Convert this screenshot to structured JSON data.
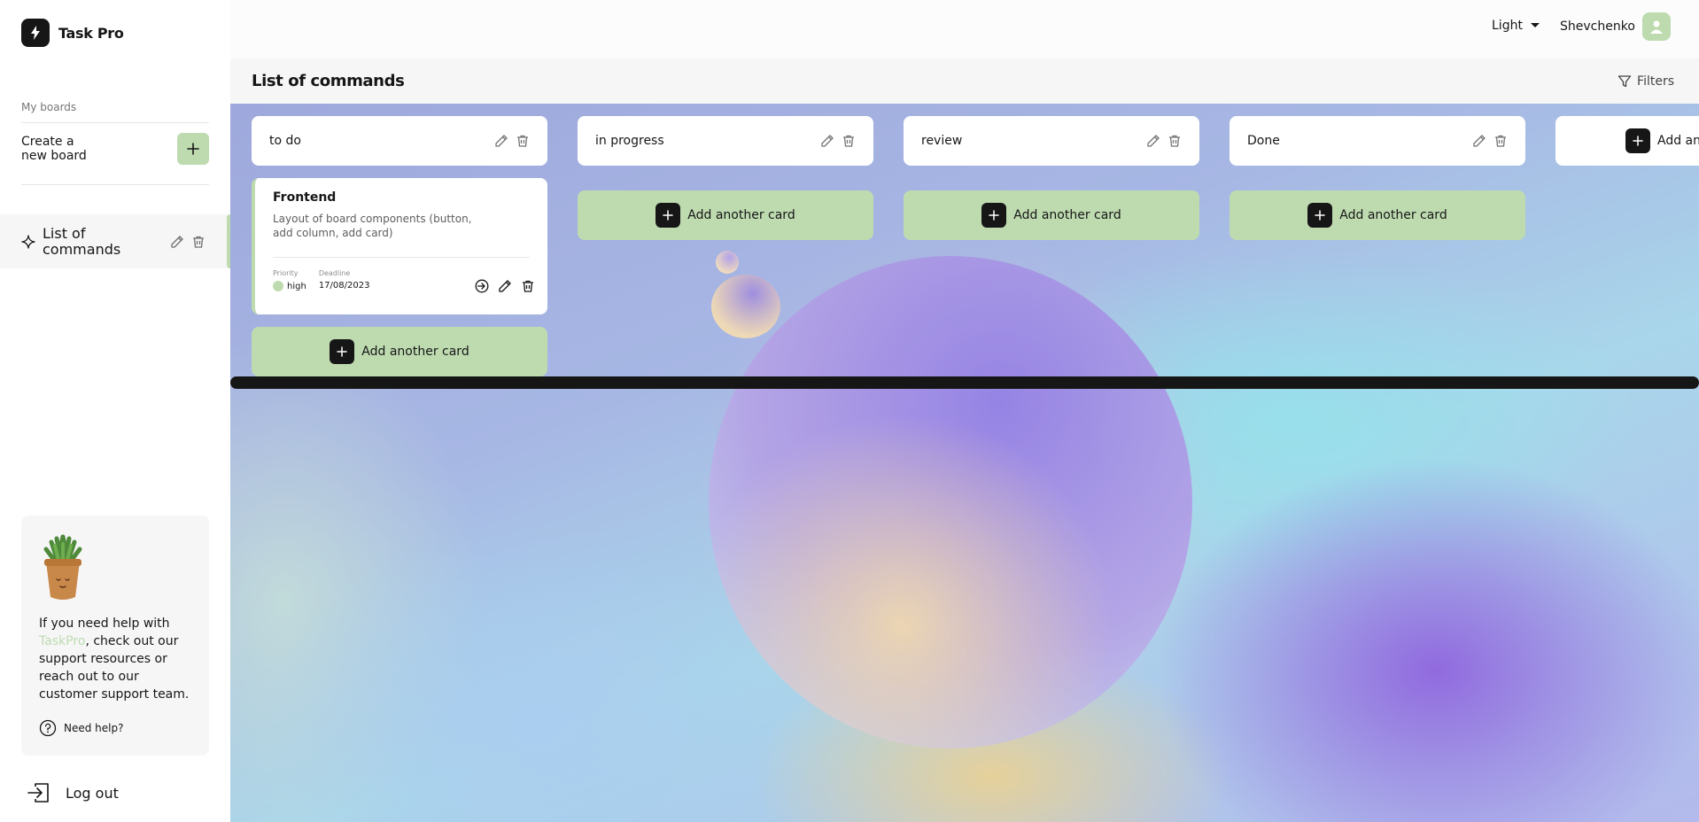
{
  "app": {
    "name": "Task Pro"
  },
  "sidebar": {
    "my_boards_label": "My boards",
    "create_board_label": "Create a new board",
    "boards": [
      {
        "label": "List of commands",
        "icon": "sparkle-icon"
      }
    ],
    "help": {
      "text_before": "If you need help with ",
      "text_accent": "TaskPro",
      "text_after": ", check out our support resources or reach out to our customer support team.",
      "need_help_label": "Need help?"
    },
    "logout_label": "Log out"
  },
  "header": {
    "theme_label": "Light",
    "user_name": "Shevchenko"
  },
  "board": {
    "title": "List of commands",
    "filters_label": "Filters",
    "add_card_label": "Add another card",
    "add_column_label": "Add another column",
    "columns": [
      {
        "title": "to do",
        "cards": [
          {
            "title": "Frontend",
            "description": "Layout of board components (button, add column, add card)",
            "priority_label": "Priority",
            "priority": "high",
            "deadline_label": "Deadline",
            "deadline": "17/08/2023"
          }
        ]
      },
      {
        "title": "in progress",
        "cards": []
      },
      {
        "title": "review",
        "cards": []
      },
      {
        "title": "Done",
        "cards": []
      }
    ]
  },
  "colors": {
    "accent": "#bedbb0",
    "dark": "#161616",
    "priority_high": "#bedbb0"
  }
}
